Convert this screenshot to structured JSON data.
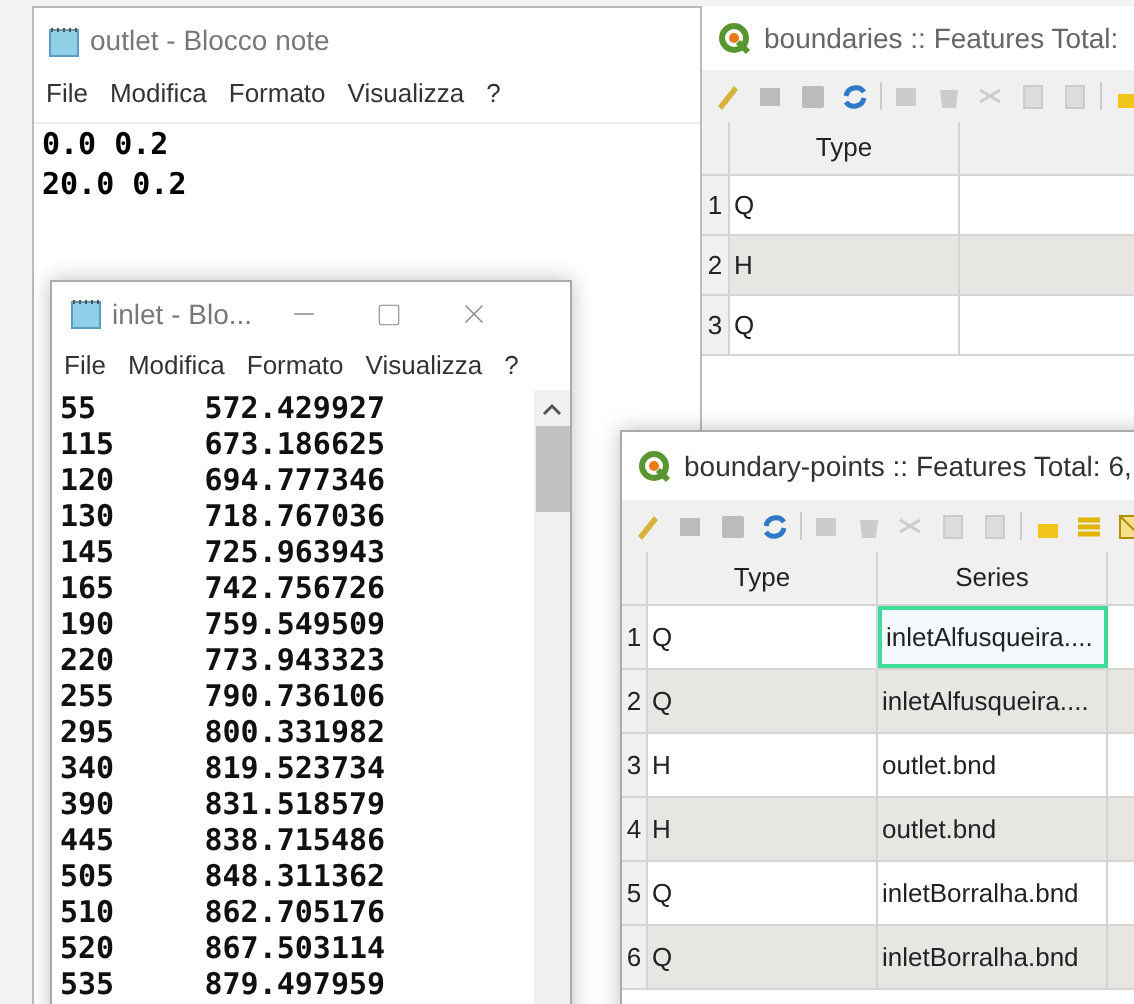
{
  "outlet_notepad": {
    "title": "outlet - Blocco note",
    "menu": [
      "File",
      "Modifica",
      "Formato",
      "Visualizza",
      "?"
    ],
    "lines": [
      "0.0 0.2",
      "20.0 0.2"
    ]
  },
  "boundaries_table": {
    "title": "boundaries :: Features Total:",
    "columns": [
      "Type"
    ],
    "rows": [
      {
        "number": "1",
        "cells": [
          "Q"
        ]
      },
      {
        "number": "2",
        "cells": [
          "H"
        ]
      },
      {
        "number": "3",
        "cells": [
          "Q"
        ]
      }
    ]
  },
  "inlet_notepad": {
    "title": "inlet - Blo...",
    "menu": [
      "File",
      "Modifica",
      "Formato",
      "Visualizza",
      "?"
    ],
    "lines": [
      "55\t572.429927",
      "115\t673.186625",
      "120\t694.777346",
      "130\t718.767036",
      "145\t725.963943",
      "165\t742.756726",
      "190\t759.549509",
      "220\t773.943323",
      "255\t790.736106",
      "295\t800.331982",
      "340\t819.523734",
      "390\t831.518579",
      "445\t838.715486",
      "505\t848.311362",
      "510\t862.705176",
      "520\t867.503114",
      "535\t879.497959"
    ]
  },
  "boundary_points_table": {
    "title": "boundary-points :: Features Total: 6,",
    "columns": [
      "Type",
      "Series"
    ],
    "rows": [
      {
        "number": "1",
        "cells": [
          "Q",
          "inletAlfusqueira...."
        ],
        "selected": true
      },
      {
        "number": "2",
        "cells": [
          "Q",
          "inletAlfusqueira...."
        ],
        "selected": false
      },
      {
        "number": "3",
        "cells": [
          "H",
          "outlet.bnd"
        ],
        "selected": false
      },
      {
        "number": "4",
        "cells": [
          "H",
          "outlet.bnd"
        ],
        "selected": false
      },
      {
        "number": "5",
        "cells": [
          "Q",
          "inletBorralha.bnd"
        ],
        "selected": false
      },
      {
        "number": "6",
        "cells": [
          "Q",
          "inletBorralha.bnd"
        ],
        "selected": false
      }
    ]
  }
}
